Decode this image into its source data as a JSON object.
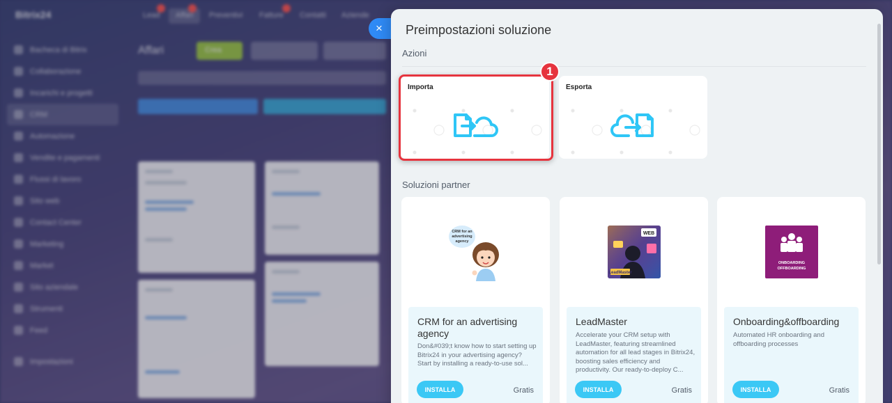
{
  "background": {
    "logo": "Bitrix24",
    "top_tabs": [
      {
        "label": "Lead",
        "active": false
      },
      {
        "label": "Affari",
        "active": true
      },
      {
        "label": "Preventivi",
        "active": false
      },
      {
        "label": "Fatture",
        "active": false
      },
      {
        "label": "Contatti",
        "active": false
      },
      {
        "label": "Aziende",
        "active": false
      }
    ],
    "sidebar": [
      {
        "label": "Bacheca di Bitrix",
        "active": false
      },
      {
        "label": "Collaborazione",
        "active": false
      },
      {
        "label": "Incarichi e progetti",
        "active": false
      },
      {
        "label": "CRM",
        "active": true
      },
      {
        "label": "Automazione",
        "active": false
      },
      {
        "label": "Vendite e pagamenti",
        "active": false
      },
      {
        "label": "Flussi di lavoro",
        "active": false
      },
      {
        "label": "Sito web",
        "active": false
      },
      {
        "label": "Contact Center",
        "active": false
      },
      {
        "label": "Marketing",
        "active": false
      },
      {
        "label": "Market",
        "active": false
      },
      {
        "label": "Sito aziendale",
        "active": false
      },
      {
        "label": "Strumenti",
        "active": false
      },
      {
        "label": "Feed",
        "active": false
      },
      {
        "label": "Impostazioni",
        "active": false
      }
    ],
    "page_title": "Affari",
    "add_button": "Crea"
  },
  "panel": {
    "title": "Preimpostazioni soluzione",
    "close_icon": "×",
    "actions_label": "Azioni",
    "actions": [
      {
        "label": "Importa",
        "icon": "import-icon"
      },
      {
        "label": "Esporta",
        "icon": "export-icon"
      }
    ],
    "step_badge": "1",
    "partners_label": "Soluzioni partner",
    "partners": [
      {
        "name": "CRM for an advertising agency",
        "description": "Don&#039;t know how to start setting up Bitrix24 in your advertising agency? Start by installing a ready-to-use sol...",
        "install_label": "INSTALLA",
        "price": "Gratis",
        "image_caption": "CRM for an advertising agency"
      },
      {
        "name": "LeadMaster",
        "description": "Accelerate your CRM setup with LeadMaster, featuring streamlined automation for all lead stages in Bitrix24, boosting sales efficiency and productivity. Our ready-to-deploy C...",
        "install_label": "INSTALLA",
        "price": "Gratis",
        "image_caption": "LeadMaster"
      },
      {
        "name": "Onboarding&offboarding",
        "description": "Automated HR onboarding and offboarding processes",
        "install_label": "INSTALLA",
        "price": "Gratis",
        "image_caption": "ONBOARDING OFFBOARDING"
      }
    ]
  },
  "colors": {
    "accent": "#2f8af5",
    "install": "#3bc8f5",
    "highlight": "#e6343e",
    "icon": "#2fc6f6"
  }
}
